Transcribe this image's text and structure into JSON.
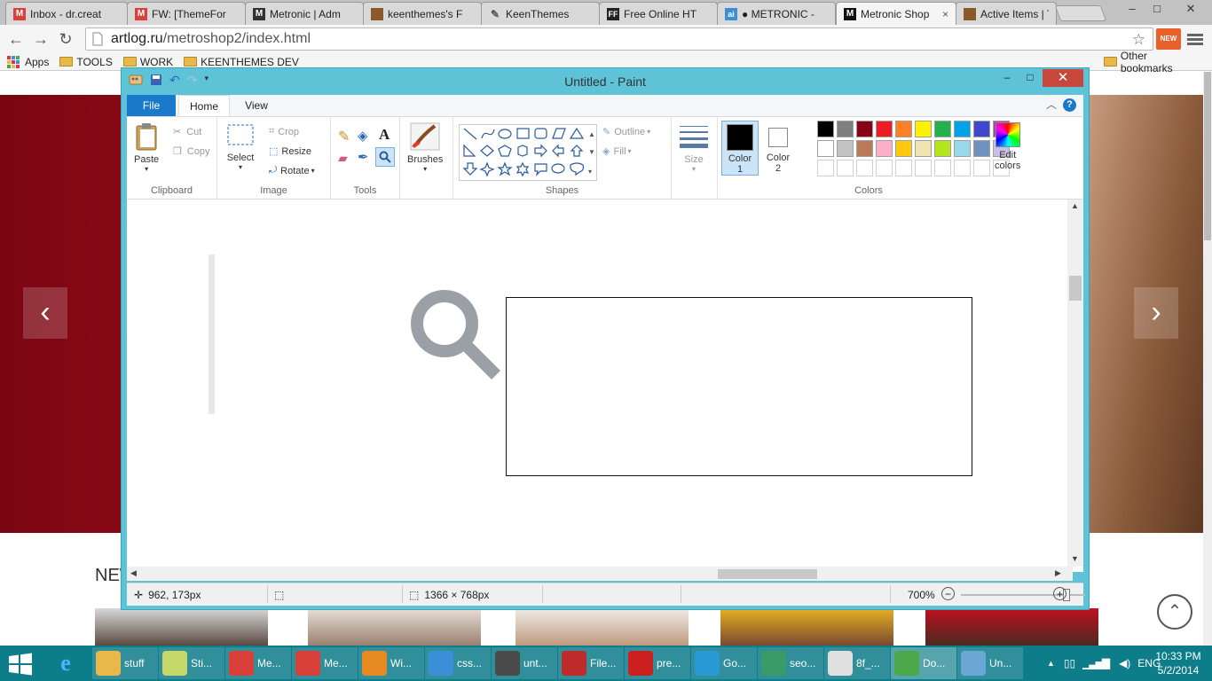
{
  "browser": {
    "tabs": [
      {
        "title": "Inbox - dr.creat",
        "icon": "gmail-icon",
        "color": "#d9403a"
      },
      {
        "title": "FW: [ThemeFor",
        "icon": "gmail-icon",
        "color": "#d9403a"
      },
      {
        "title": "Metronic | Adm",
        "icon": "metronic-m-icon",
        "color": "#333333"
      },
      {
        "title": "keenthemes's F",
        "icon": "keenthemes-avatar-icon",
        "color": "#8a5a2a"
      },
      {
        "title": "KeenThemes",
        "icon": "pen-icon",
        "color": "#555555"
      },
      {
        "title": "Free Online HT",
        "icon": "ff-icon",
        "color": "#222222"
      },
      {
        "title": "● METRONIC -",
        "icon": "ai-icon",
        "color": "#3a8fd6"
      },
      {
        "title": "Metronic Shop",
        "icon": "metronic-m-icon",
        "color": "#111111",
        "active": true
      },
      {
        "title": "Active Items | T",
        "icon": "keenthemes-avatar-icon",
        "color": "#8a5a2a"
      }
    ],
    "close_glyph": "×",
    "url_host": "artlog.ru",
    "url_path": "/metroshop2/index.html",
    "new_badge": "NEW",
    "window_controls": {
      "min": "–",
      "max": "□",
      "close": "✕"
    },
    "bookmarks": [
      {
        "label": "Apps",
        "type": "apps"
      },
      {
        "label": "TOOLS",
        "type": "folder"
      },
      {
        "label": "WORK",
        "type": "folder"
      },
      {
        "label": "KEENTHEMES DEV",
        "type": "folder"
      }
    ],
    "other_bookmarks": "Other bookmarks"
  },
  "website": {
    "section_heading": "NEW",
    "prev_arrow": "‹",
    "next_arrow": "›",
    "scroll_top": "⌃",
    "colors": {
      "hero": "#b01020"
    }
  },
  "paint": {
    "title": "Untitled - Paint",
    "window_controls": {
      "min": "–",
      "max": "□",
      "close": "✕"
    },
    "tabs": {
      "file": "File",
      "home": "Home",
      "view": "View"
    },
    "help": "?",
    "clipboard": {
      "paste": "Paste",
      "cut": "Cut",
      "copy": "Copy",
      "label": "Clipboard"
    },
    "image": {
      "select": "Select",
      "crop": "Crop",
      "resize": "Resize",
      "rotate": "Rotate",
      "label": "Image"
    },
    "tools": {
      "label": "Tools",
      "text_tool": "A"
    },
    "brushes": {
      "label": "Brushes"
    },
    "shapes": {
      "label": "Shapes",
      "outline": "Outline",
      "fill": "Fill"
    },
    "size": {
      "label": "Size"
    },
    "color1": {
      "label": "Color",
      "num": "1",
      "value": "#000000"
    },
    "color2": {
      "label": "Color",
      "num": "2",
      "value": "#ffffff"
    },
    "colors": {
      "label": "Colors",
      "row1": [
        "#000000",
        "#7f7f7f",
        "#880015",
        "#ed1c24",
        "#ff7f27",
        "#fff200",
        "#22b14c",
        "#00a2e8",
        "#3f48cc",
        "#a349a4"
      ],
      "row2": [
        "#ffffff",
        "#c3c3c3",
        "#b97a57",
        "#ffaec9",
        "#ffc90e",
        "#efe4b0",
        "#b5e61d",
        "#99d9ea",
        "#7092be",
        "#c8bfe7"
      ],
      "row3": [
        "#ffffff",
        "#ffffff",
        "#ffffff",
        "#ffffff",
        "#ffffff",
        "#ffffff",
        "#ffffff",
        "#ffffff",
        "#ffffff",
        "#ffffff"
      ]
    },
    "edit_colors": {
      "line1": "Edit",
      "line2": "colors"
    },
    "status": {
      "cursor": "962, 173px",
      "size": "1366 × 768px",
      "zoom": "700%"
    },
    "zoom_level": 0.85
  },
  "taskbar": {
    "items": [
      {
        "label": "stuff",
        "icon": "folder-icon",
        "color": "#e8b84a",
        "state": "open"
      },
      {
        "label": "Sti...",
        "icon": "sticky-notes-icon",
        "color": "#c7d86a",
        "state": "open"
      },
      {
        "label": "Me...",
        "icon": "chrome-icon",
        "color": "#d9403a",
        "state": "open"
      },
      {
        "label": "Me...",
        "icon": "chrome-icon",
        "color": "#d9403a",
        "state": "open"
      },
      {
        "label": "Wi...",
        "icon": "media-player-icon",
        "color": "#e88a22",
        "state": "open"
      },
      {
        "label": "css...",
        "icon": "safari-icon",
        "color": "#3a8fd6",
        "state": "open"
      },
      {
        "label": "unt...",
        "icon": "sublime-icon",
        "color": "#4a4a4a",
        "state": "open"
      },
      {
        "label": "File...",
        "icon": "filezilla-icon",
        "color": "#bf2a2a",
        "state": "open"
      },
      {
        "label": "pre...",
        "icon": "opera-icon",
        "color": "#cc1f1f",
        "state": "open"
      },
      {
        "label": "Go...",
        "icon": "google-talk-icon",
        "color": "#2a9ad6",
        "state": "open"
      },
      {
        "label": "seo...",
        "icon": "chat-icon",
        "color": "#3a9a6a",
        "state": "open"
      },
      {
        "label": "8f_...",
        "icon": "calendar-icon",
        "color": "#e0e0e0",
        "state": "open"
      },
      {
        "label": "Do...",
        "icon": "download-icon",
        "color": "#4aa84a",
        "state": "active"
      },
      {
        "label": "Un...",
        "icon": "paint-icon",
        "color": "#6aa6d6",
        "state": "open"
      }
    ],
    "tray": {
      "lang": "ENG",
      "up": "▲"
    },
    "clock": {
      "time": "10:33 PM",
      "date": "5/2/2014"
    }
  }
}
